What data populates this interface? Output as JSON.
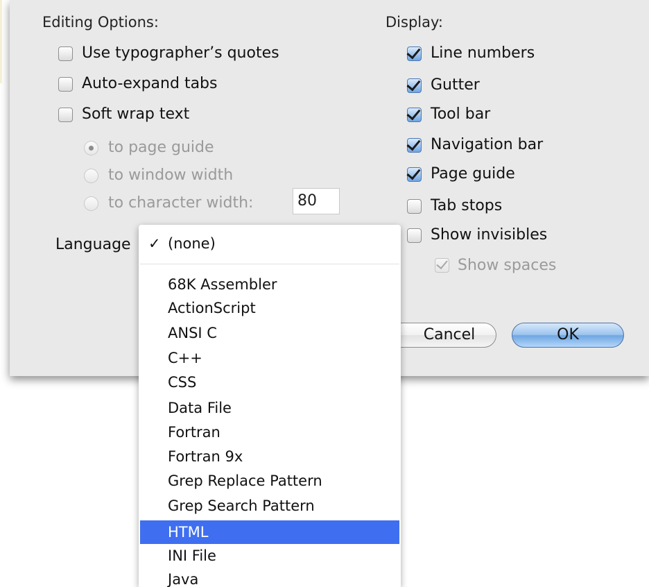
{
  "editing": {
    "heading": "Editing Options:",
    "options": [
      {
        "label": "Use typographer’s quotes",
        "checked": false
      },
      {
        "label": "Auto-expand tabs",
        "checked": false
      },
      {
        "label": "Soft wrap text",
        "checked": false
      }
    ],
    "wrap_modes": [
      {
        "label": "to page guide",
        "selected": true
      },
      {
        "label": "to window width",
        "selected": false
      },
      {
        "label": "to character width:",
        "selected": false
      }
    ],
    "character_width": "80",
    "language_label": "Language"
  },
  "display": {
    "heading": "Display:",
    "options": [
      {
        "label": "Line numbers",
        "checked": true
      },
      {
        "label": "Gutter",
        "checked": true
      },
      {
        "label": "Tool bar",
        "checked": true
      },
      {
        "label": "Navigation bar",
        "checked": true
      },
      {
        "label": "Page guide",
        "checked": true
      },
      {
        "label": "Tab stops",
        "checked": false
      },
      {
        "label": "Show invisibles",
        "checked": false
      }
    ],
    "sub_option": {
      "label": "Show spaces",
      "checked": true,
      "enabled": false
    }
  },
  "buttons": {
    "cancel": "Cancel",
    "ok": "OK"
  },
  "language_menu": {
    "checkmark": "✓",
    "selected": "(none)",
    "items": [
      "68K Assembler",
      "ActionScript",
      "ANSI C",
      "C++",
      "CSS",
      "Data File",
      "Fortran",
      "Fortran 9x",
      "Grep Replace Pattern",
      "Grep Search Pattern",
      "HTML",
      "INI File",
      "Java"
    ],
    "highlighted": "HTML"
  }
}
